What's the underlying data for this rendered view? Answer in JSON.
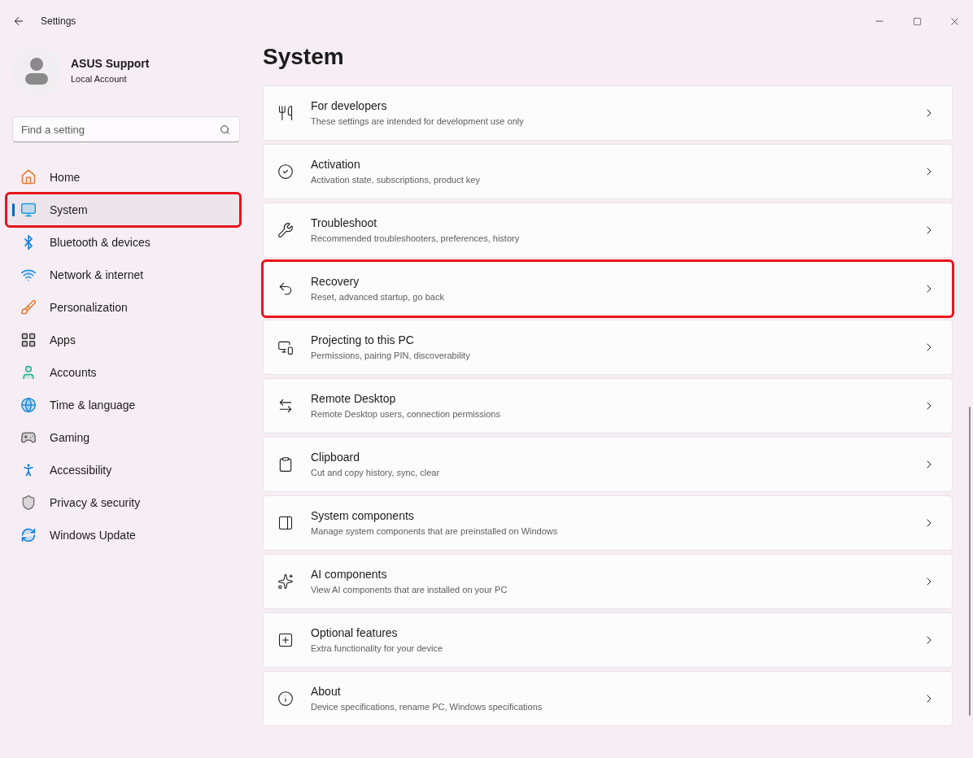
{
  "window": {
    "title": "Settings"
  },
  "account": {
    "name": "ASUS Support",
    "type": "Local Account"
  },
  "search": {
    "placeholder": "Find a setting"
  },
  "sidebar": {
    "items": [
      {
        "label": "Home",
        "selected": false,
        "highlighted": false
      },
      {
        "label": "System",
        "selected": true,
        "highlighted": true
      },
      {
        "label": "Bluetooth & devices",
        "selected": false,
        "highlighted": false
      },
      {
        "label": "Network & internet",
        "selected": false,
        "highlighted": false
      },
      {
        "label": "Personalization",
        "selected": false,
        "highlighted": false
      },
      {
        "label": "Apps",
        "selected": false,
        "highlighted": false
      },
      {
        "label": "Accounts",
        "selected": false,
        "highlighted": false
      },
      {
        "label": "Time & language",
        "selected": false,
        "highlighted": false
      },
      {
        "label": "Gaming",
        "selected": false,
        "highlighted": false
      },
      {
        "label": "Accessibility",
        "selected": false,
        "highlighted": false
      },
      {
        "label": "Privacy & security",
        "selected": false,
        "highlighted": false
      },
      {
        "label": "Windows Update",
        "selected": false,
        "highlighted": false
      }
    ]
  },
  "page": {
    "title": "System",
    "items": [
      {
        "title": "For developers",
        "description": "These settings are intended for development use only",
        "highlighted": false
      },
      {
        "title": "Activation",
        "description": "Activation state, subscriptions, product key",
        "highlighted": false
      },
      {
        "title": "Troubleshoot",
        "description": "Recommended troubleshooters, preferences, history",
        "highlighted": false
      },
      {
        "title": "Recovery",
        "description": "Reset, advanced startup, go back",
        "highlighted": true
      },
      {
        "title": "Projecting to this PC",
        "description": "Permissions, pairing PIN, discoverability",
        "highlighted": false
      },
      {
        "title": "Remote Desktop",
        "description": "Remote Desktop users, connection permissions",
        "highlighted": false
      },
      {
        "title": "Clipboard",
        "description": "Cut and copy history, sync, clear",
        "highlighted": false
      },
      {
        "title": "System components",
        "description": "Manage system components that are preinstalled on Windows",
        "highlighted": false
      },
      {
        "title": "AI components",
        "description": "View AI components that are installed on your PC",
        "highlighted": false
      },
      {
        "title": "Optional features",
        "description": "Extra functionality for your device",
        "highlighted": false
      },
      {
        "title": "About",
        "description": "Device specifications, rename PC, Windows specifications",
        "highlighted": false
      }
    ]
  }
}
